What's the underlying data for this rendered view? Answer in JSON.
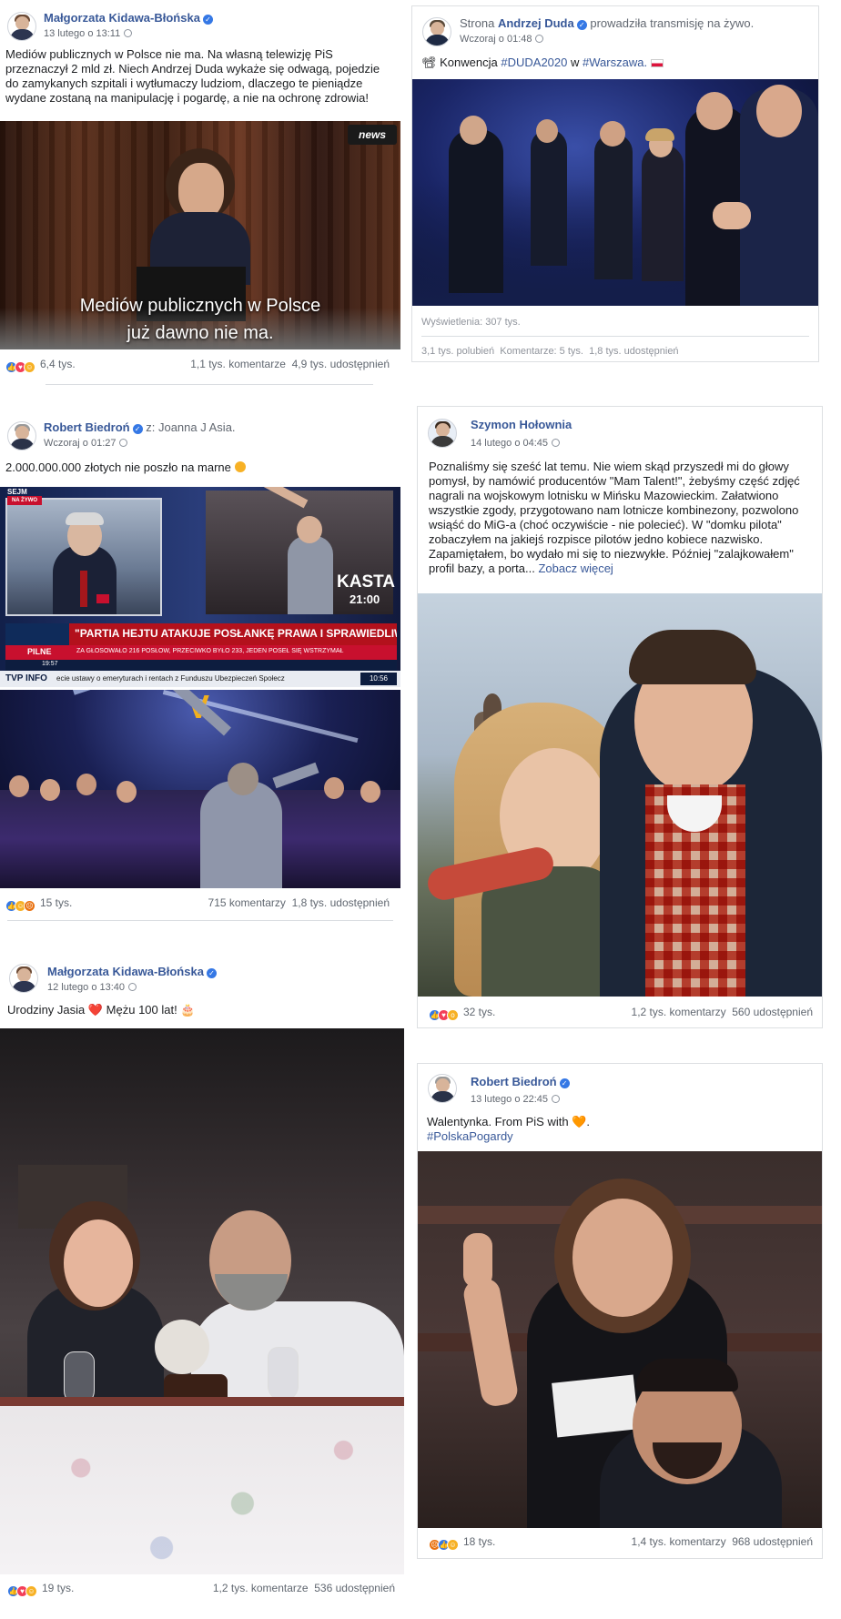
{
  "posts": {
    "p1": {
      "author": "Małgorzata Kidawa-Błońska",
      "time": "13 lutego o 13:11",
      "text": "Mediów publicznych w Polsce nie ma. Na własną telewizję PiS przeznaczył 2 mld zł. Niech Andrzej Duda wykaże się odwagą, pojedzie do zamykanych szpitali i wytłumaczy ludziom, dlaczego te pieniądze wydane zostaną na manipulację i pogardę, a nie na ochronę zdrowia!",
      "video_caption_line1": "Mediów publicznych w Polsce",
      "video_caption_line2": "już dawno nie ma.",
      "video_logo": "news",
      "reactions_count": "6,4 tys.",
      "comments": "1,1 tys. komentarze",
      "shares": "4,9 tys. udostępnień"
    },
    "p2": {
      "prefix": "Strona",
      "author": "Andrzej Duda",
      "suffix": "prowadziła transmisję na żywo.",
      "time": "Wczoraj o 01:48",
      "text_prefix": "Konwencja",
      "hashtag1": "#DUDA2020",
      "text_mid": "w",
      "hashtag2": "#Warszawa.",
      "views": "Wyświetlenia: 307 tys.",
      "likes": "3,1 tys. polubień",
      "comments": "Komentarze: 5 tys.",
      "shares": "1,8 tys. udostępnień"
    },
    "p3": {
      "author": "Robert Biedroń",
      "with": "z: Joanna J Asia.",
      "time": "Wczoraj o 01:27",
      "text": "2.000.000.000 złotych nie poszło na marne",
      "tv_badge": "SEJM",
      "tv_live": "NA ŻYWO",
      "tv_headline": "\"PARTIA HEJTU ATAKUJE POSŁANKĘ PRAWA I SPRAWIEDLIWOŚCI\"",
      "tv_pilne": "PILNE",
      "tv_ticker": "ZA GŁOSOWAŁO 216 POSŁÓW, PRZECIWKO BYŁO 233, JEDEN POSEŁ SIĘ WSTRZYMAŁ",
      "tv_ticker2": "ecie ustawy o emeryturach i rentach z Funduszu Ubezpieczeń Społecz",
      "tv_time1": "19:57",
      "tv_time2": "10:56",
      "tv_info": "TVP INFO",
      "kasta": "KASTA",
      "kasta_time": "21:00",
      "reactions_count": "15 tys.",
      "comments": "715 komentarzy",
      "shares": "1,8 tys. udostępnień"
    },
    "p4": {
      "author": "Szymon Hołownia",
      "time": "14 lutego o 04:45",
      "text": "Poznaliśmy się sześć lat temu. Nie wiem skąd przyszedł mi do głowy pomysł, by namówić producentów \"Mam Talent!\", żebyśmy część zdjęć nagrali na wojskowym lotnisku w Mińsku Mazowieckim. Załatwiono wszystkie zgody, przygotowano nam lotnicze kombinezony, pozwolono wsiąść do MiG-a (choć oczywiście - nie polecieć). W \"domku pilota\" zobaczyłem na jakiejś rozpisce pilotów jedno kobiece nazwisko. Zapamiętałem, bo wydało mi się to niezwykłe. Później \"zalajkowałem\" profil bazy, a porta...",
      "more": "Zobacz więcej",
      "reactions_count": "32 tys.",
      "comments": "1,2 tys. komentarzy",
      "shares": "560 udostępnień"
    },
    "p5": {
      "author": "Małgorzata Kidawa-Błońska",
      "time": "12 lutego o 13:40",
      "text": "Urodziny Jasia ❤️ Mężu 100 lat! 🎂",
      "reactions_count": "19 tys.",
      "comments": "1,2 tys. komentarze",
      "shares": "536 udostępnień"
    },
    "p6": {
      "author": "Robert Biedroń",
      "time": "13 lutego o 22:45",
      "text": "Walentynka. From PiS with 🧡.",
      "hashtag": "#PolskaPogardy",
      "reactions_count": "18 tys.",
      "comments": "1,4 tys. komentarzy",
      "shares": "968 udostępnień"
    }
  },
  "colors": {
    "link": "#385898",
    "meta": "#616770",
    "like": "#3578e5",
    "love": "#f33e58",
    "haha": "#f7b125",
    "angry": "#e9710f",
    "verified": "#3578e5"
  },
  "icons": [
    "verified-icon",
    "globe-icon",
    "like-reaction-icon",
    "love-reaction-icon",
    "haha-reaction-icon",
    "wow-reaction-icon",
    "angry-reaction-icon",
    "video-camera-icon"
  ]
}
